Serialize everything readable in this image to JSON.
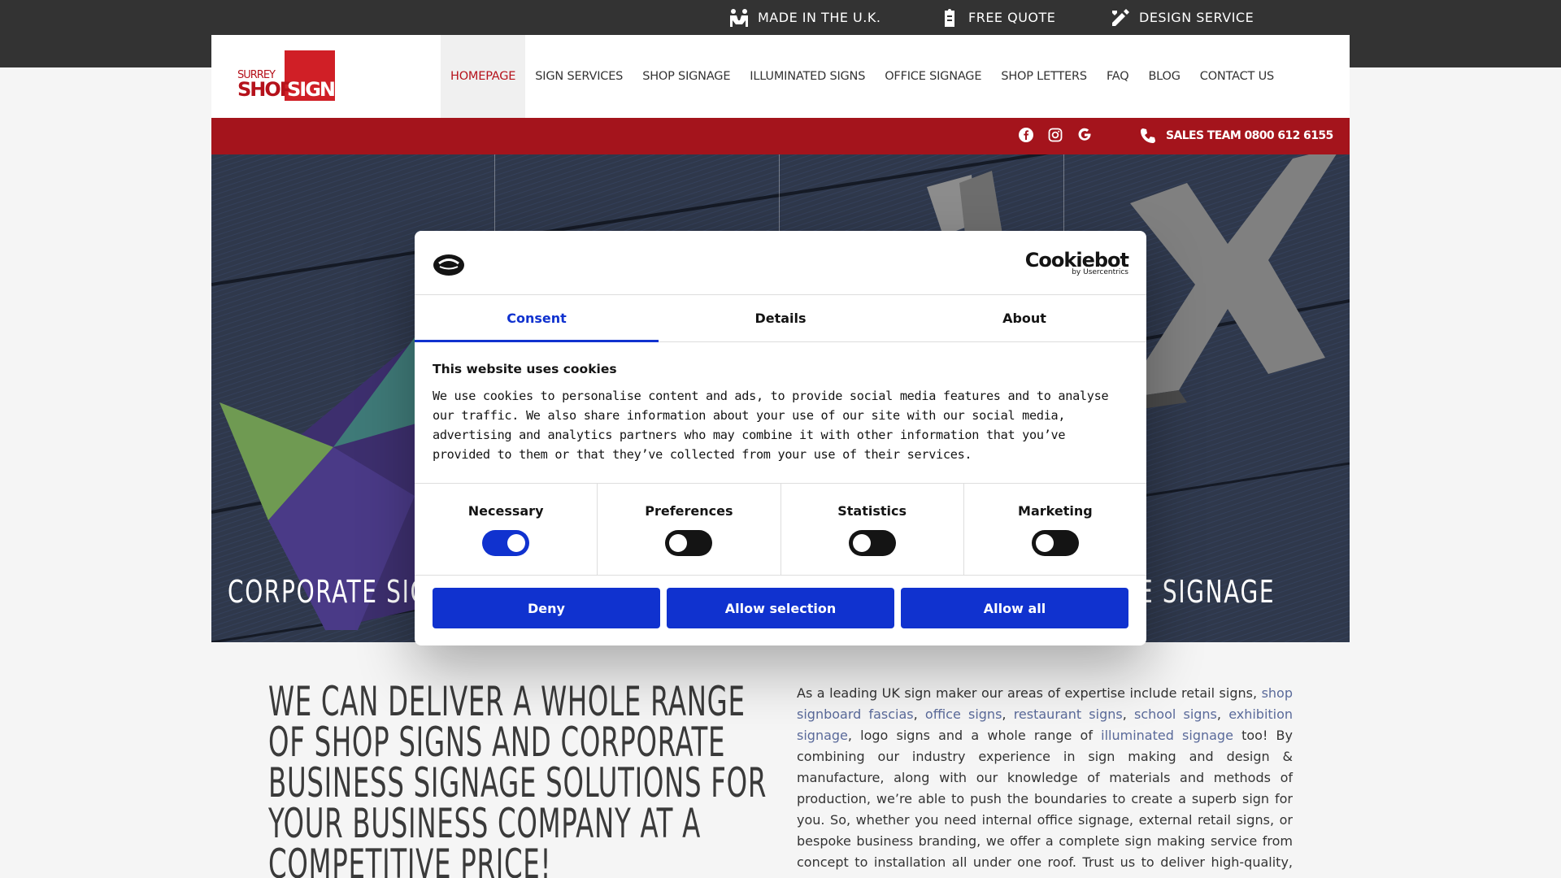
{
  "topbar": {
    "items": [
      {
        "label": "MADE IN THE U.K.",
        "icon": "people-carry-icon"
      },
      {
        "label": "FREE QUOTE",
        "icon": "clipboard-icon"
      },
      {
        "label": "DESIGN SERVICE",
        "icon": "design-tools-icon"
      }
    ]
  },
  "logo": {
    "line1": "SURREY",
    "line2": "SHOP",
    "line3": "SIGNS"
  },
  "nav": {
    "items": [
      {
        "label": "HOMEPAGE",
        "active": true
      },
      {
        "label": "SIGN SERVICES"
      },
      {
        "label": "SHOP SIGNAGE"
      },
      {
        "label": "ILLUMINATED SIGNS"
      },
      {
        "label": "OFFICE SIGNAGE"
      },
      {
        "label": "SHOP LETTERS"
      },
      {
        "label": "FAQ"
      },
      {
        "label": "BLOG"
      },
      {
        "label": "CONTACT US"
      }
    ]
  },
  "redbar": {
    "social_icons": [
      "facebook-icon",
      "instagram-icon",
      "google-icon"
    ],
    "phone_label": "SALES TEAM 0800 612 6155"
  },
  "hero": {
    "caption_left": "CORPORATE SIGN",
    "caption_right": "E SIGNAGE"
  },
  "cookie_dialog": {
    "brand": "Cookiebot",
    "brand_sub": "by Usercentrics",
    "tabs": [
      "Consent",
      "Details",
      "About"
    ],
    "active_tab": "Consent",
    "title": "This website uses cookies",
    "body": "We use cookies to personalise content and ads, to provide social media features and to analyse our traffic. We also share information about your use of our site with our social media, advertising and analytics partners who may combine it with other information that you’ve provided to them or that they’ve collected from your use of their services.",
    "toggles": [
      {
        "label": "Necessary",
        "on": true
      },
      {
        "label": "Preferences",
        "on": false
      },
      {
        "label": "Statistics",
        "on": false
      },
      {
        "label": "Marketing",
        "on": false
      }
    ],
    "buttons": {
      "deny": "Deny",
      "allow_selection": "Allow selection",
      "allow_all": "Allow all"
    },
    "accent": "#1032cf"
  },
  "main": {
    "headline": "WE CAN DELIVER A WHOLE RANGE OF SHOP SIGNS AND CORPORATE BUSINESS SIGNAGE SOLUTIONS FOR YOUR BUSINESS COMPANY AT A COMPETITIVE PRICE!",
    "para": {
      "t1": "As a leading UK sign maker our areas of expertise include retail signs, ",
      "l1": "shop signboard fascias",
      "t2": ", ",
      "l2": "office signs",
      "t3": ", ",
      "l3": "restaurant signs",
      "t4": ", ",
      "l4": "school signs",
      "t5": ", ",
      "l5": "exhibition signage",
      "t6": ", logo signs and a whole range of ",
      "l6": "illuminated signage",
      "t7": " too! By combining our industry experience in sign making and design & manufacture, along with our knowledge of materials and methods of production, we’re able to push the boundaries to create a superb sign for you. So, whether you need internal office signage, external retail signs, or bespoke business branding, we offer a complete sign making service from concept to installation all under one roof. Trust us to deliver high-quality, durable signage that enhances your visibility and"
    }
  },
  "colors": {
    "brand_red": "#a4141c",
    "dark": "#333333"
  }
}
